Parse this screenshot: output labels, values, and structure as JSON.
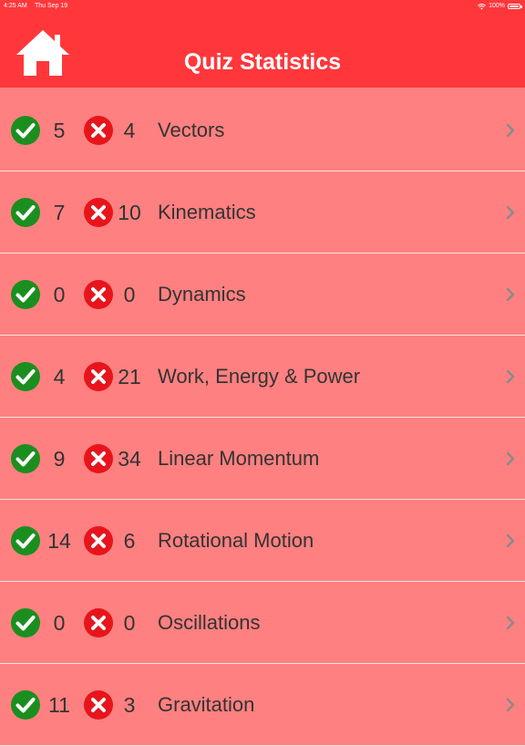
{
  "status_bar": {
    "time": "4:25 AM",
    "date": "Thu Sep 19",
    "battery": "100%"
  },
  "header": {
    "title": "Quiz Statistics",
    "home_icon": "home-icon"
  },
  "colors": {
    "header": "#ff373b",
    "background": "#ff8080",
    "correct": "#1a8f1f",
    "wrong": "#e8141c"
  },
  "topics": [
    {
      "correct": "5",
      "wrong": "4",
      "name": "Vectors"
    },
    {
      "correct": "7",
      "wrong": "10",
      "name": "Kinematics"
    },
    {
      "correct": "0",
      "wrong": "0",
      "name": "Dynamics"
    },
    {
      "correct": "4",
      "wrong": "21",
      "name": "Work, Energy & Power"
    },
    {
      "correct": "9",
      "wrong": "34",
      "name": "Linear Momentum"
    },
    {
      "correct": "14",
      "wrong": "6",
      "name": "Rotational Motion"
    },
    {
      "correct": "0",
      "wrong": "0",
      "name": "Oscillations"
    },
    {
      "correct": "11",
      "wrong": "3",
      "name": "Gravitation"
    }
  ]
}
